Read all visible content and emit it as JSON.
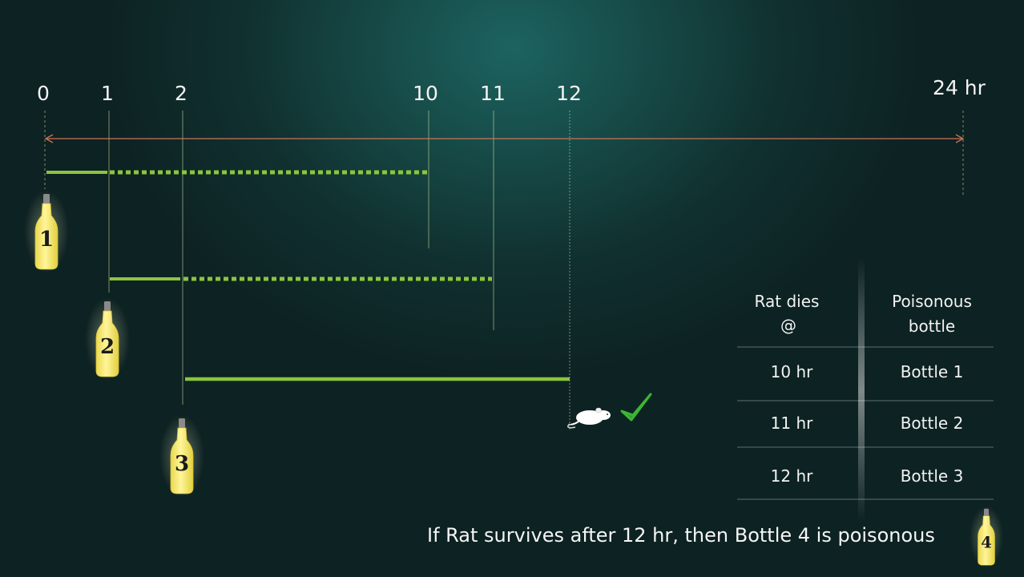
{
  "timeline": {
    "tick_labels": [
      "0",
      "1",
      "2",
      "10",
      "11",
      "12",
      "24 hr"
    ]
  },
  "bottles": [
    {
      "label": "1"
    },
    {
      "label": "2"
    },
    {
      "label": "3"
    },
    {
      "label": "4"
    }
  ],
  "table": {
    "header_left_line1": "Rat dies",
    "header_left_line2": "@",
    "header_right_line1": "Poisonous",
    "header_right_line2": "bottle",
    "rows": [
      {
        "time": "10 hr",
        "bottle": "Bottle 1"
      },
      {
        "time": "11 hr",
        "bottle": "Bottle 2"
      },
      {
        "time": "12 hr",
        "bottle": "Bottle 3"
      }
    ]
  },
  "caption": "If Rat survives after 12 hr, then Bottle 4 is poisonous",
  "colors": {
    "bar": "#8cc43f",
    "axis_arrow": "#c9755a",
    "bottle_liquid": "#f2e36a",
    "check": "#2f9e2a"
  }
}
